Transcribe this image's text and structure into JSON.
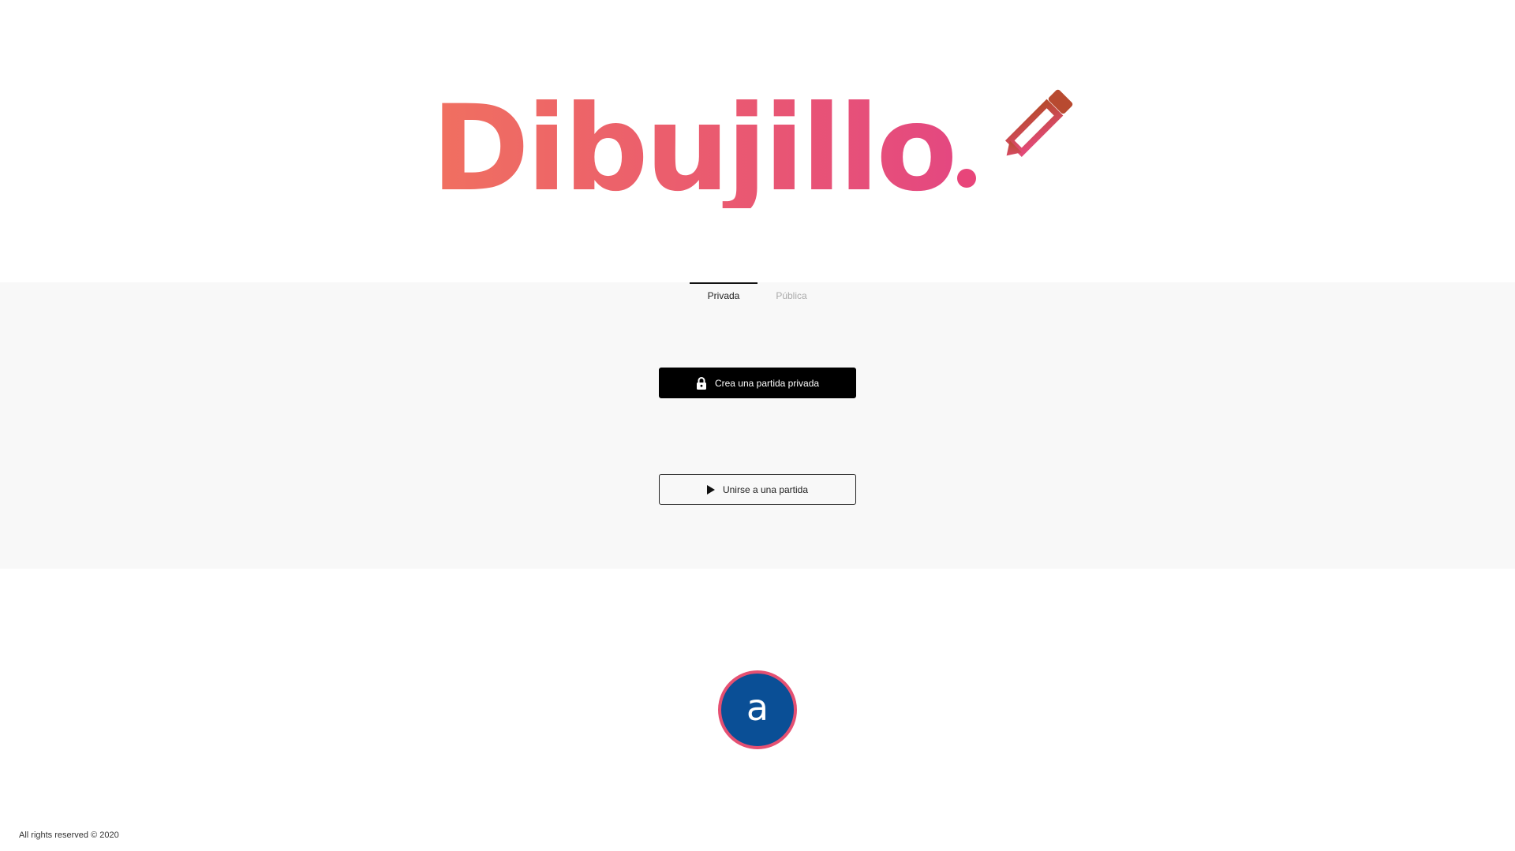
{
  "brand": {
    "name": "Dibujillo",
    "icon": "pencil-icon",
    "gradient_start": "#f07060",
    "gradient_end": "#e44880"
  },
  "tabs": [
    {
      "label": "Privada",
      "active": true
    },
    {
      "label": "Pública",
      "active": false
    }
  ],
  "actions": {
    "create_private": {
      "label": "Crea una partida privada",
      "icon": "lock-icon"
    },
    "join_game": {
      "label": "Unirse a una partida",
      "icon": "play-icon"
    }
  },
  "user": {
    "avatar_letter": "a",
    "avatar_color": "#0a4f96",
    "avatar_border": "#e55072"
  },
  "footer": {
    "copyright": "All rights reserved © 2020"
  }
}
